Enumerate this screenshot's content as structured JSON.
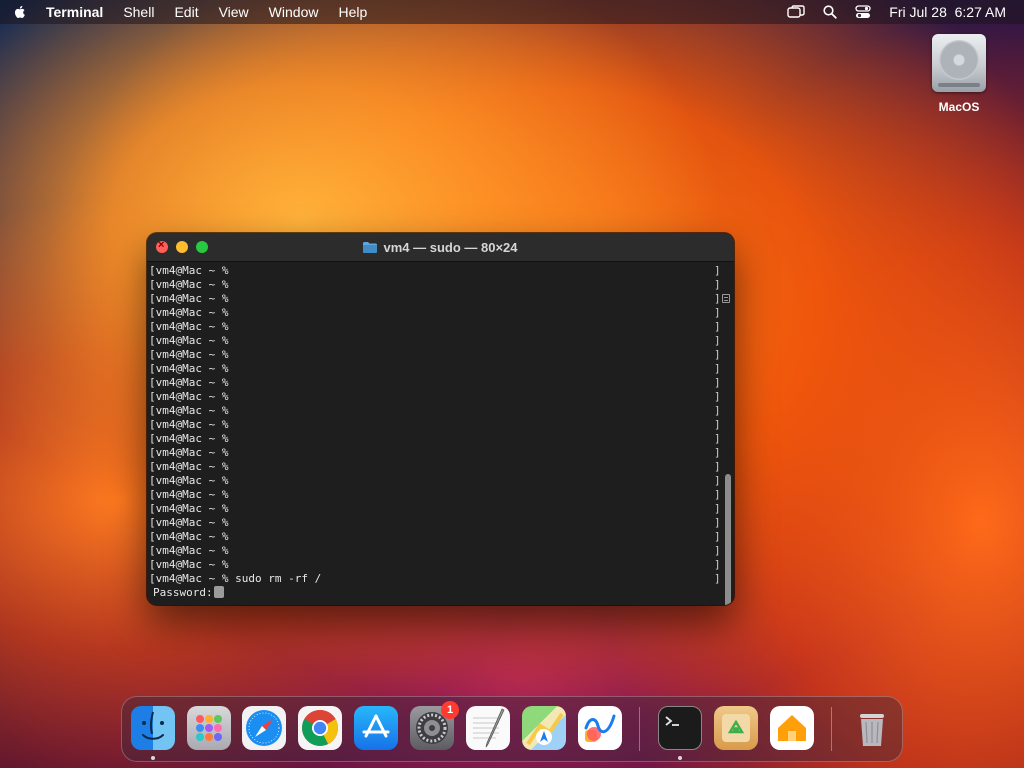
{
  "menubar": {
    "app_name": "Terminal",
    "menus": [
      "Shell",
      "Edit",
      "View",
      "Window",
      "Help"
    ],
    "datetime": "Fri Jul 28  6:27 AM"
  },
  "desktop": {
    "drive_label": "MacOS"
  },
  "terminal": {
    "title": "vm4 — sudo — 80×24",
    "prompt_lines": [
      "[vm4@Mac ~ % ",
      "[vm4@Mac ~ % ",
      "[vm4@Mac ~ % ",
      "[vm4@Mac ~ % ",
      "[vm4@Mac ~ % ",
      "[vm4@Mac ~ % ",
      "[vm4@Mac ~ % ",
      "[vm4@Mac ~ % ",
      "[vm4@Mac ~ % ",
      "[vm4@Mac ~ % ",
      "[vm4@Mac ~ % ",
      "[vm4@Mac ~ % ",
      "[vm4@Mac ~ % ",
      "[vm4@Mac ~ % ",
      "[vm4@Mac ~ % ",
      "[vm4@Mac ~ % ",
      "[vm4@Mac ~ % ",
      "[vm4@Mac ~ % ",
      "[vm4@Mac ~ % ",
      "[vm4@Mac ~ % ",
      "[vm4@Mac ~ % ",
      "[vm4@Mac ~ % ",
      "[vm4@Mac ~ % sudo rm -rf /"
    ],
    "line_end": "]",
    "password_prompt": "Password:"
  },
  "dock": {
    "settings_badge": "1",
    "items": [
      "finder-icon",
      "launchpad-icon",
      "safari-icon",
      "chrome-icon",
      "app-store-icon",
      "system-settings-icon",
      "textedit-icon",
      "maps-icon",
      "freeform-icon",
      "terminal-icon",
      "archive-utility-icon",
      "home-icon",
      "trash-icon"
    ]
  },
  "colors": {
    "close": "#ff5f57",
    "minimize": "#febc2e",
    "maximize": "#28c840",
    "badge": "#ff3b30",
    "terminal_bg": "#1e1e1e"
  }
}
